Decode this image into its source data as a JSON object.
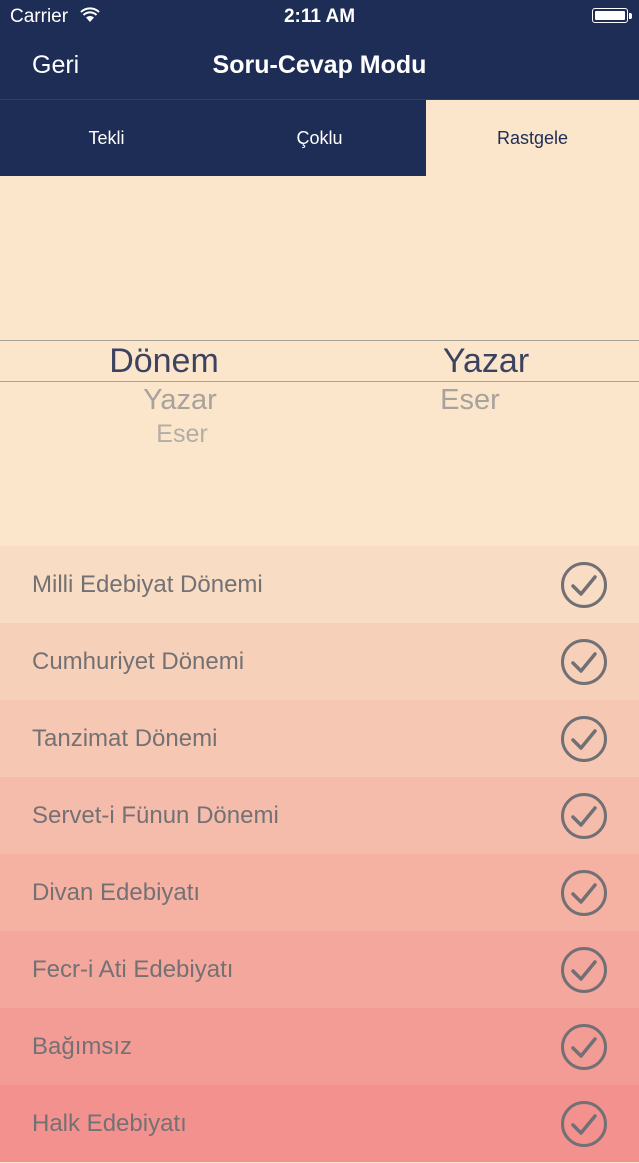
{
  "status_bar": {
    "carrier": "Carrier",
    "time": "2:11 AM"
  },
  "nav": {
    "back_label": "Geri",
    "title": "Soru-Cevap Modu"
  },
  "tabs": [
    {
      "label": "Tekli",
      "active": false
    },
    {
      "label": "Çoklu",
      "active": false
    },
    {
      "label": "Rastgele",
      "active": true
    }
  ],
  "picker": {
    "left_column": {
      "selected": "Dönem",
      "options_below": [
        "Yazar",
        "Eser"
      ]
    },
    "right_column": {
      "selected": "Yazar",
      "options_below": [
        "Eser"
      ]
    }
  },
  "list": {
    "items": [
      {
        "label": "Milli Edebiyat Dönemi",
        "color": "#f8dcc3",
        "checked": true
      },
      {
        "label": "Cumhuriyet Dönemi",
        "color": "#f7d0b9",
        "checked": true
      },
      {
        "label": "Tanzimat Dönemi",
        "color": "#f6c7b2",
        "checked": true
      },
      {
        "label": "Servet-i Fünun Dönemi",
        "color": "#f5bcab",
        "checked": true
      },
      {
        "label": "Divan Edebiyatı",
        "color": "#f5b2a3",
        "checked": true
      },
      {
        "label": "Fecr-i Ati Edebiyatı",
        "color": "#f4a79c",
        "checked": true
      },
      {
        "label": "Bağımsız",
        "color": "#f39c95",
        "checked": true
      },
      {
        "label": "Halk Edebiyatı",
        "color": "#f3918f",
        "checked": true
      }
    ],
    "check_color": "#717075"
  },
  "colors": {
    "navy": "#1e2d55",
    "cream": "#fbe5cb"
  }
}
